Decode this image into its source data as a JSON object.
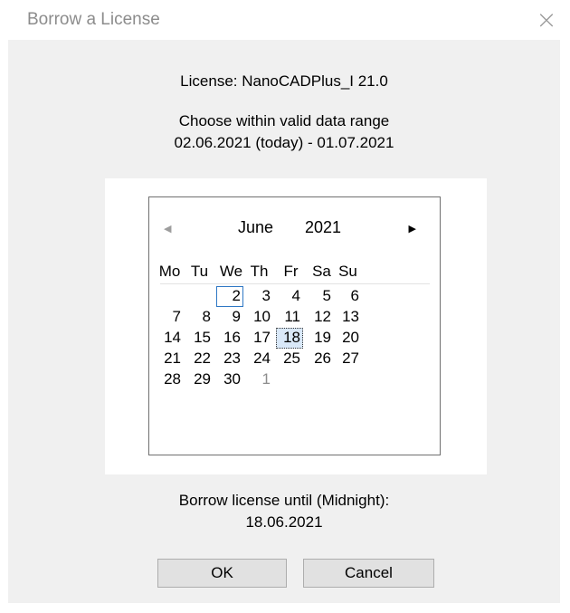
{
  "window": {
    "title": "Borrow a License",
    "close_icon": "×"
  },
  "license_line": "License: NanoCADPlus_I 21.0",
  "range_prompt": "Choose within valid data range",
  "range_value": "02.06.2021 (today) - 01.07.2021",
  "calendar": {
    "prev_icon": "◀",
    "next_icon": "▶",
    "month": "June",
    "year": "2021",
    "weekdays": [
      "Mo",
      "Tu",
      "We",
      "Th",
      "Fr",
      "Sa",
      "Su"
    ],
    "weeks": [
      [
        "",
        "",
        "2",
        "3",
        "4",
        "5",
        "6"
      ],
      [
        "7",
        "8",
        "9",
        "10",
        "11",
        "12",
        "13"
      ],
      [
        "14",
        "15",
        "16",
        "17",
        "18",
        "19",
        "20"
      ],
      [
        "21",
        "22",
        "23",
        "24",
        "25",
        "26",
        "27"
      ],
      [
        "28",
        "29",
        "30",
        "1",
        "",
        "",
        ""
      ]
    ],
    "today": "2",
    "selected": "18"
  },
  "borrow_label": "Borrow license until (Midnight):",
  "borrow_value": "18.06.2021",
  "buttons": {
    "ok": "OK",
    "cancel": "Cancel"
  }
}
